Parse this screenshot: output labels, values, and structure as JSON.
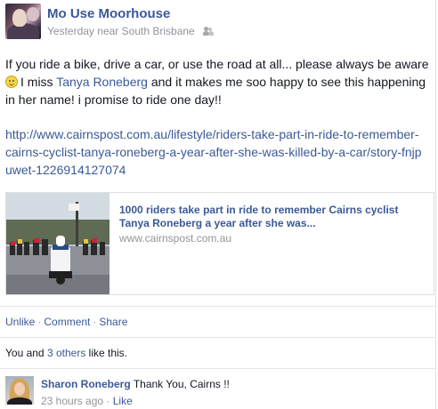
{
  "post": {
    "author": "Mo Use Moorhouse",
    "time": "Yesterday",
    "near_word": "near",
    "location": "South Brisbane",
    "privacy_icon": "friends-icon",
    "text_line1": "If you ride a bike, drive a car, or use the road at all... please always be aware",
    "text_line2_pre": "I miss",
    "mention": "Tanya Roneberg",
    "text_line2_post": "and it makes me soo happy to see this happening",
    "text_line3": "in her name! i promise to ride one day!!",
    "link": "http://www.cairnspost.com.au/lifestyle/riders-take-part-in-ride-to-remember-cairns-cyclist-tanya-roneberg-a-year-after-she-was-killed-by-a-car/story-fnjpuwet-1226914127074"
  },
  "attachment": {
    "title": "1000 riders take part in ride to remember Cairns cyclist Tanya Roneberg a year after she was...",
    "domain": "www.cairnspost.com.au"
  },
  "actions": {
    "unlike": "Unlike",
    "comment": "Comment",
    "share": "Share",
    "separator": "·"
  },
  "likes": {
    "prefix": "You and",
    "others": "3 others",
    "suffix": "like this."
  },
  "comment": {
    "author": "Sharon Roneberg",
    "text": "Thank You, Cairns !!",
    "time": "23 hours ago",
    "separator": "·",
    "like": "Like"
  },
  "colors": {
    "link": "#3b5998",
    "meta": "#90949c",
    "text": "#141823"
  }
}
